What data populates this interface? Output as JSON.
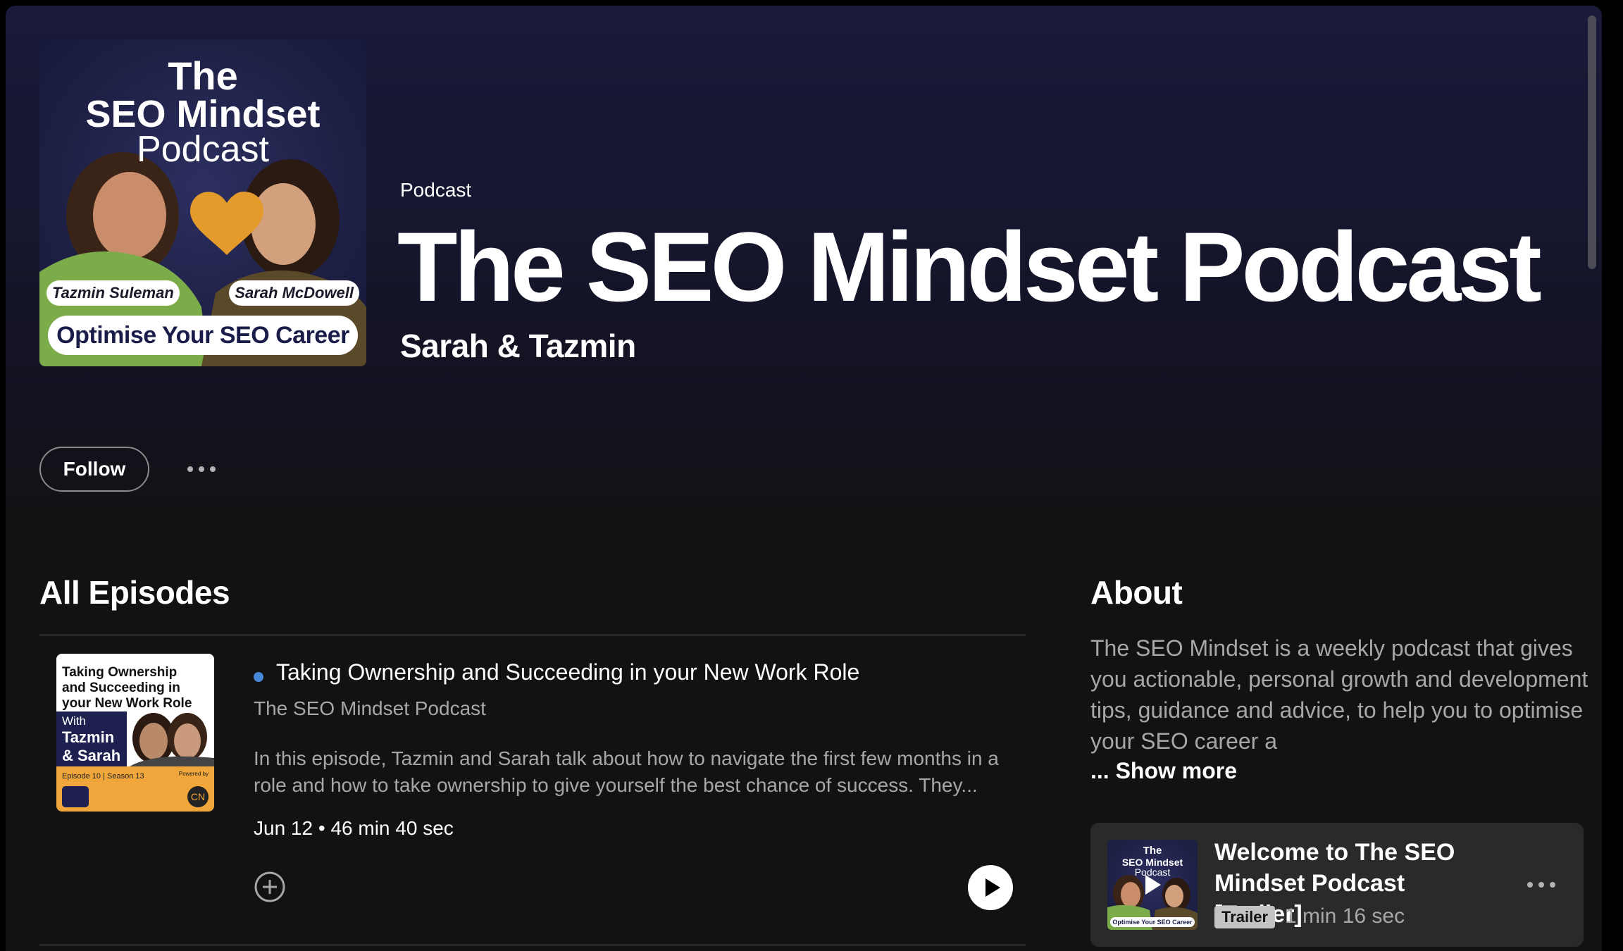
{
  "header": {
    "type_label": "Podcast",
    "title": "The SEO Mindset Podcast",
    "author": "Sarah & Tazmin",
    "cover": {
      "line1": "The",
      "line2": "SEO Mindset",
      "line3": "Podcast",
      "host_left": "Tazmin Suleman",
      "host_right": "Sarah McDowell",
      "banner": "Optimise Your SEO Career"
    }
  },
  "actions": {
    "follow_label": "Follow",
    "more_icon": "more-horizontal-icon"
  },
  "episodes": {
    "heading": "All Episodes",
    "items": [
      {
        "title": "Taking Ownership and Succeeding in your New Work Role",
        "show": "The SEO Mindset Podcast",
        "description": "In this episode, Tazmin and Sarah talk about how to navigate the first few months in a role and how to take ownership to give yourself the best chance of success. They...",
        "date": "Jun 12",
        "separator": "•",
        "duration": "46 min 40 sec",
        "is_new": true,
        "thumb": {
          "topic": "Taking Ownership and Succeeding in your New Work Role",
          "with": "With",
          "hosts": "Tazmin & Sarah",
          "season": "Episode 10 | Season 13",
          "powered": "Powered by",
          "badge": "CN"
        }
      }
    ]
  },
  "about": {
    "heading": "About",
    "text": "The SEO Mindset is a weekly podcast that gives you actionable, personal growth and development tips, guidance and advice, to help you to optimise your SEO career a",
    "show_more": "... Show more",
    "trailer": {
      "title": "Welcome to The SEO Mindset Podcast [Trailer]",
      "badge": "Trailer",
      "duration": "1 min 16 sec",
      "thumb": {
        "line1": "The",
        "line2": "SEO Mindset",
        "line3": "Podcast",
        "banner": "Optimise Your SEO Career"
      }
    }
  },
  "colors": {
    "background": "#121212",
    "header_gradient_top": "#1a1a3a",
    "new_dot": "#4687d6",
    "text_secondary": "#a7a7a7",
    "card": "#2a2a2a",
    "thumb_orange": "#f0a63a"
  }
}
